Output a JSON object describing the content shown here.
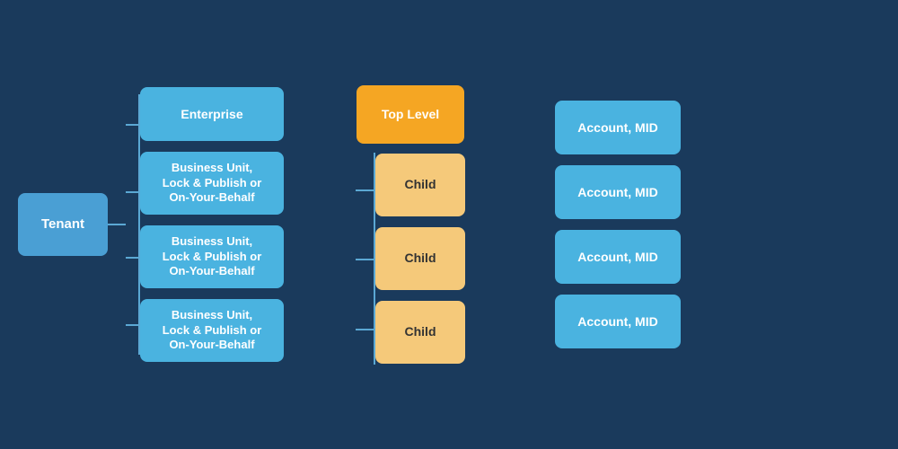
{
  "tenant": {
    "label": "Tenant"
  },
  "column1": {
    "enterprise_label": "Enterprise",
    "bu_items": [
      {
        "label": "Business Unit,\nLock & Publish or\nOn-Your-Behalf"
      },
      {
        "label": "Business Unit,\nLock & Publish or\nOn-Your-Behalf"
      },
      {
        "label": "Business Unit,\nLock & Publish or\nOn-Your-Behalf"
      }
    ]
  },
  "column2": {
    "top_level_label": "Top Level",
    "child_items": [
      {
        "label": "Child"
      },
      {
        "label": "Child"
      },
      {
        "label": "Child"
      }
    ]
  },
  "column3": {
    "account_items": [
      {
        "label": "Account, MID"
      },
      {
        "label": "Account, MID"
      },
      {
        "label": "Account, MID"
      },
      {
        "label": "Account, MID"
      }
    ]
  }
}
